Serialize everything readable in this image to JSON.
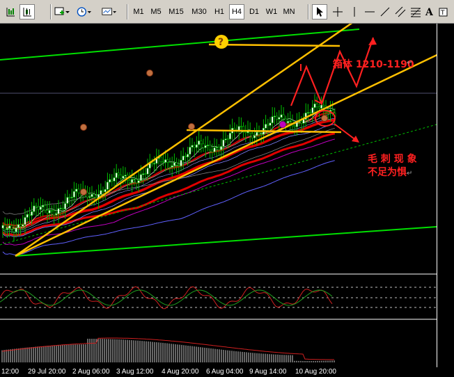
{
  "toolbar": {
    "timeframes": [
      "M1",
      "M5",
      "M15",
      "M30",
      "H1",
      "H4",
      "D1",
      "W1",
      "MN"
    ],
    "active_timeframe": "H4",
    "tools": [
      "chart-bar-icon",
      "chart-candle-icon",
      "new-chart-icon",
      "clock-icon",
      "template-icon",
      "cursor-icon",
      "crosshair-icon",
      "vertical-line-icon",
      "horizontal-line-icon",
      "trendline-icon",
      "equidistant-channel-icon",
      "fibonacci-icon",
      "text-icon",
      "text-label-icon"
    ]
  },
  "annotations": {
    "box_label": "箱体 1210-1190",
    "spike_line1": "毛 刺 现 象",
    "spike_line2": "不足为惧",
    "question_mark": "?",
    "return_glyph": "↵"
  },
  "x_axis": {
    "labels": [
      "12:00",
      "29 Jul 20:00",
      "2 Aug 06:00",
      "3 Aug 12:00",
      "4 Aug 20:00",
      "6 Aug 04:00",
      "9 Aug 14:00",
      "10 Aug 20:00"
    ]
  },
  "colors": {
    "background": "#000000",
    "candle_up": "#ffffff",
    "candle_down": "#000000",
    "candle_body_up": "#00c000",
    "annotation_red": "#ff2020",
    "annotation_yellow": "#ffc000",
    "channel_green": "#00e000",
    "ma_red": "#e00000"
  }
}
